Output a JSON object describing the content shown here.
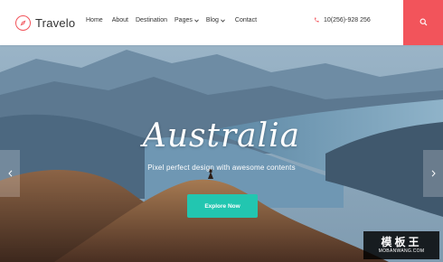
{
  "brand": {
    "name": "Travelo",
    "logo_icon": "compass-icon",
    "accent": "#f2545b"
  },
  "nav": {
    "items": [
      {
        "label": "Home"
      },
      {
        "label": "About"
      },
      {
        "label": "Destination"
      },
      {
        "label": "Pages"
      },
      {
        "label": "Blog"
      },
      {
        "label": "Contact"
      }
    ]
  },
  "phone": {
    "number": "10(256)-928 256",
    "icon": "phone-icon"
  },
  "search": {
    "icon": "search-icon",
    "color": "#f2545b"
  },
  "hero": {
    "title": "Australia",
    "subtitle": "Pixel perfect design with awesome contents",
    "button_label": "Explore Now",
    "button_color": "#22c6b0"
  },
  "slider": {
    "prev_icon": "chevron-left-icon",
    "next_icon": "chevron-right-icon"
  },
  "watermark": {
    "main": "模板王",
    "url": "MOBANWANG.COM"
  }
}
